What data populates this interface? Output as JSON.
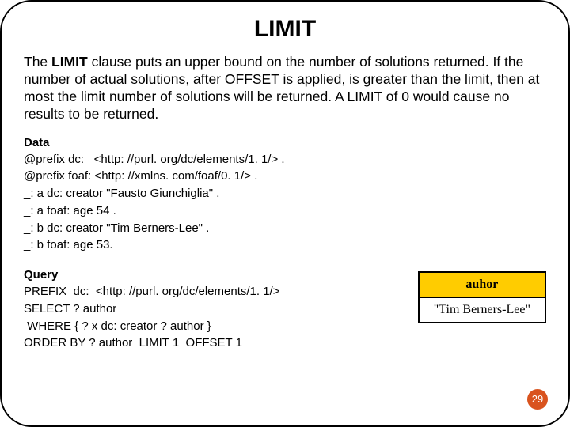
{
  "title": "LIMIT",
  "desc_pre": "The ",
  "desc_kw": "LIMIT",
  "desc_post": " clause puts an upper bound on the number of solutions returned. If the number of actual solutions, after OFFSET is applied, is greater than the limit, then at most the limit number of solutions will be returned. A LIMIT of 0 would cause no results to be returned.",
  "data_label": "Data",
  "data_lines": "@prefix dc:   <http: //purl. org/dc/elements/1. 1/> .\n@prefix foaf: <http: //xmlns. com/foaf/0. 1/> .\n_: a dc: creator \"Fausto Giunchiglia\" .\n_: a foaf: age 54 .\n_: b dc: creator \"Tim Berners-Lee\" .\n_: b foaf: age 53.",
  "query_label": "Query",
  "query_lines": "PREFIX  dc:  <http: //purl. org/dc/elements/1. 1/>\nSELECT ? author\n WHERE { ? x dc: creator ? author }\nORDER BY ? author  LIMIT 1  OFFSET 1",
  "table_header": "auhor",
  "table_row": "\"Tim Berners-Lee\"",
  "page_number": "29"
}
